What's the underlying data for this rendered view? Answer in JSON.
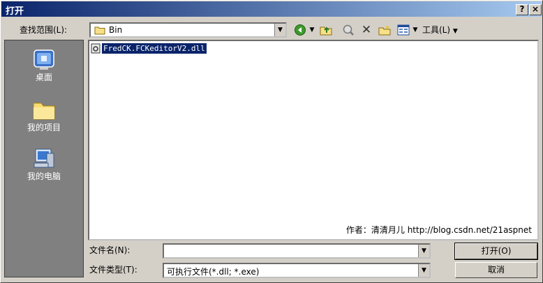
{
  "window": {
    "title": "打开",
    "help_button": "?",
    "close_button": "×"
  },
  "lookin": {
    "label": "查找范围(L):",
    "value": "Bin"
  },
  "toolbar": {
    "tools_label": "工具(L)"
  },
  "places": [
    {
      "label": "桌面",
      "icon": "desktop-icon"
    },
    {
      "label": "我的项目",
      "icon": "folder-icon"
    },
    {
      "label": "我的电脑",
      "icon": "computer-icon"
    }
  ],
  "files": [
    {
      "name": "FredCK.FCKeditorV2.dll",
      "selected": true
    }
  ],
  "watermark": "作者：清清月儿 http://blog.csdn.net/21aspnet",
  "filename": {
    "label": "文件名(N):",
    "value": ""
  },
  "filetype": {
    "label": "文件类型(T):",
    "value": "可执行文件(*.dll; *.exe)"
  },
  "buttons": {
    "open": "打开(O)",
    "cancel": "取消"
  },
  "colors": {
    "title_start": "#0a246a",
    "title_end": "#a6caf0",
    "selection": "#0a246a",
    "face": "#d4d0c8"
  }
}
